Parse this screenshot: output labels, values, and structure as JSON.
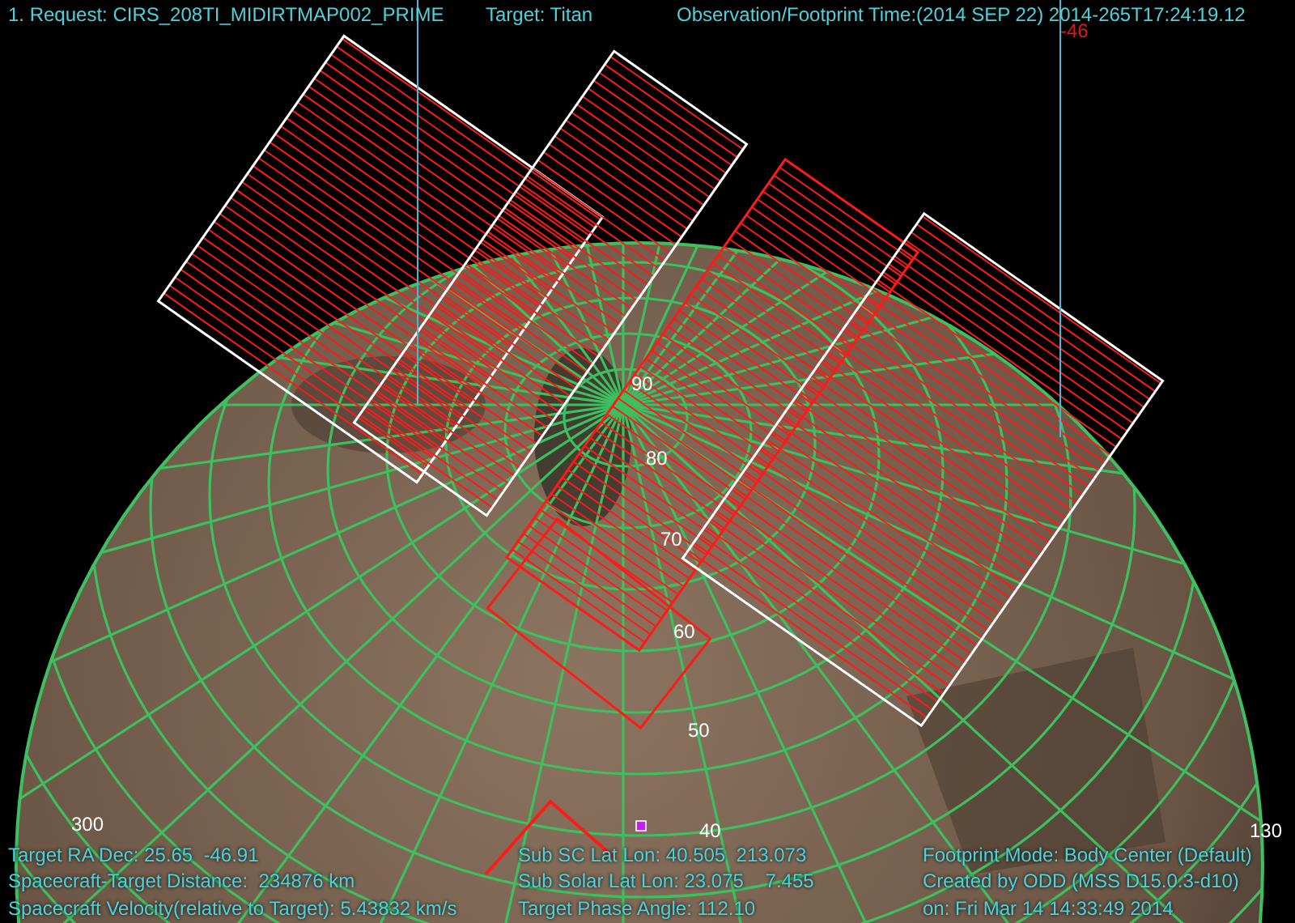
{
  "header": {
    "request": "1. Request: CIRS_208TI_MIDIRTMAP002_PRIME",
    "target": "Target: Titan",
    "time": "Observation/Footprint Time:(2014 SEP 22) 2014-265T17:24:19.12",
    "marker": "-46"
  },
  "grid_labels": [
    "90",
    "80",
    "70",
    "60",
    "50",
    "40",
    "300",
    "130"
  ],
  "footer": {
    "left": [
      "Target RA Dec: 25.65  -46.91",
      "Spacecraft-Target Distance:  234876 km",
      "Spacecraft Velocity(relative to Target): 5.43832 km/s"
    ],
    "middle": [
      "Sub SC Lat Lon: 40.505  213.073",
      "Sub Solar Lat Lon: 23.075    7.455",
      "Target Phase Angle: 112.10"
    ],
    "right": [
      "Footprint Mode: Body Center (Default)",
      "Created by ODD (MSS D15.0.3-d10)",
      "on: Fri Mar 14 14:33:49 2014"
    ]
  }
}
